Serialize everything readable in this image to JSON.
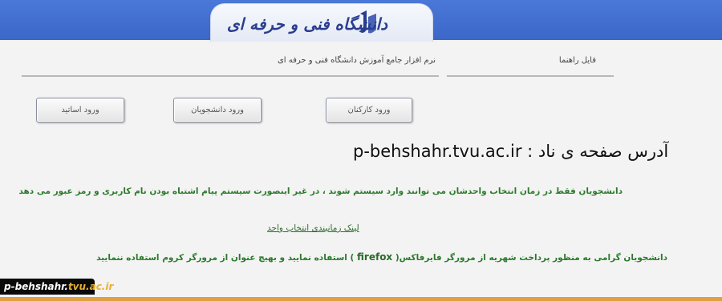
{
  "header": {
    "logo_text": "دانشگاه فنی و حرفه ای",
    "system_title": "نرم افزار جامع آموزش دانشگاه فنی و حرفه ای",
    "help_link": "فایل راهنما"
  },
  "buttons": {
    "staff_login": "ورود کارکنان",
    "student_login": "ورود دانشجویان",
    "teacher_login": "ورود اساتید"
  },
  "address": {
    "label": "آدرس صفحه ی  ناد :",
    "value": "p-behshahr.tvu.ac.ir"
  },
  "notices": {
    "line1": "دانشجویان فقط در زمان انتخاب واحدشان می توانند وارد سیستم شوند ، در غیر اینصورت سیستم پیام اشتباه بودن نام کاربری و رمز عبور می دهد",
    "link": "لینک زمانبندی انتخاب واحد",
    "line3_before": "دانشجویان گرامی به منظور پرداخت شهریه از مرورگر فایرفاکس(",
    "line3_firefox": "firefox",
    "line3_after": ") استفاده نمایید و بهیچ عنوان از مرورگر کروم استفاده ننمایید"
  },
  "footer": {
    "site_prefix": "p-behshahr.",
    "site_domain": "tvu.ac.ir"
  },
  "colors": {
    "topbar": "#3f6fd0",
    "notice_green": "#2a7a2a",
    "footer_accent": "#e0a040"
  }
}
